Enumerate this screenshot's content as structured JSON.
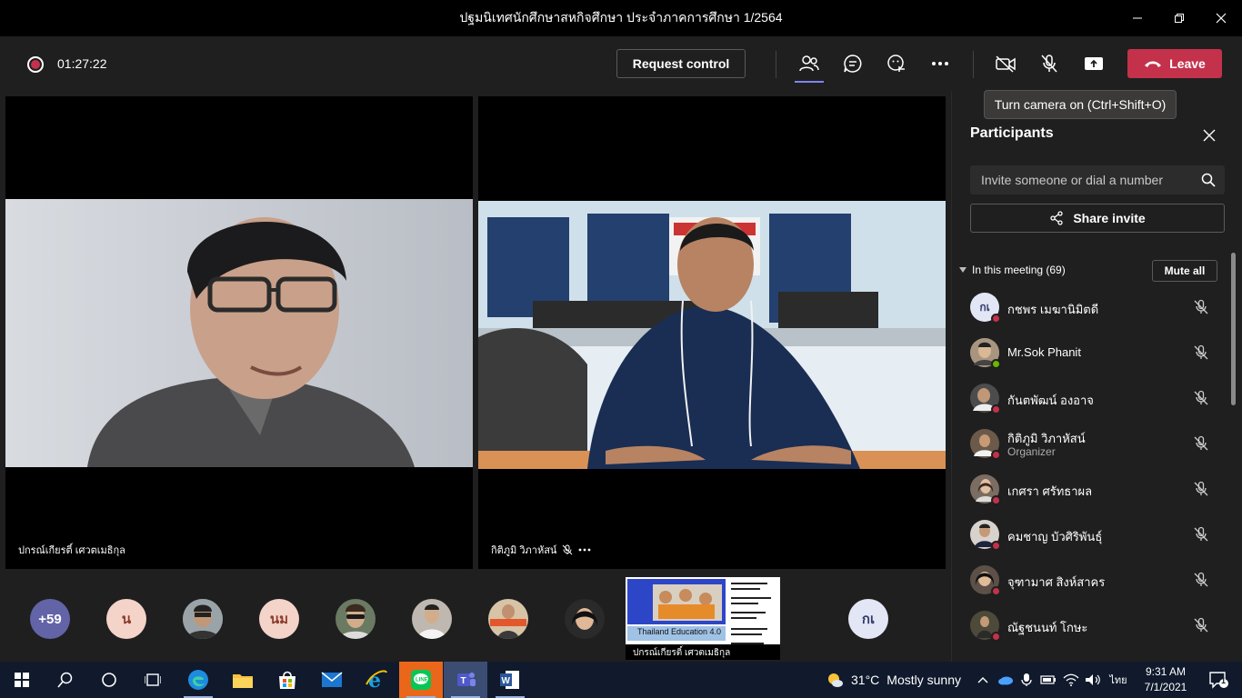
{
  "window": {
    "title": "ปฐมนิเทศนักศึกษาสหกิจศึกษา ประจำภาคการศึกษา 1/2564"
  },
  "toolbar": {
    "timer": "01:27:22",
    "request_control": "Request control",
    "leave": "Leave",
    "camera_tooltip": "Turn camera on (Ctrl+Shift+O)"
  },
  "videos": [
    {
      "name": "ปกรณ์เกียรติ์ เศวตเมธิกุล",
      "muted": false
    },
    {
      "name": "กิติภูมิ วิภาหัสน์",
      "muted": true
    }
  ],
  "strip": {
    "overflow_count": "+59",
    "avatars": [
      {
        "initials": "น",
        "bg": "#f4d3c9",
        "fg": "#8a3b2a"
      },
      {
        "initials": "",
        "photo": true
      },
      {
        "initials": "นม",
        "bg": "#f4d3c9",
        "fg": "#8a3b2a"
      },
      {
        "initials": "",
        "photo": true
      },
      {
        "initials": "",
        "photo": true
      },
      {
        "initials": "",
        "photo": true
      },
      {
        "initials": "",
        "photo": true
      },
      {
        "initials": "กเ",
        "bg": "#e3e6f5",
        "fg": "#333a6b"
      }
    ],
    "share_thumb": {
      "caption": "Thailand Education 4.0",
      "presenter": "ปกรณ์เกียรติ์ เศวตเมธิกุล"
    }
  },
  "panel": {
    "title": "Participants",
    "invite_placeholder": "Invite someone or dial a number",
    "share_invite": "Share invite",
    "section_label": "In this meeting (69)",
    "mute_all": "Mute all",
    "participants": [
      {
        "name": "กชพร เมฆานิมิตดี",
        "initials": "กเ",
        "status": "busy",
        "avatar_bg": "#e3e6f5"
      },
      {
        "name": "Mr.Sok Phanit",
        "initials": "",
        "status": "available",
        "avatar_bg": "#8a7560"
      },
      {
        "name": "กันตพัฒน์ องอาจ",
        "initials": "",
        "status": "busy",
        "avatar_bg": "#4c4c4c"
      },
      {
        "name": "กิติภูมิ วิภาหัสน์",
        "role": "Organizer",
        "initials": "",
        "status": "busy",
        "avatar_bg": "#6b5a4a"
      },
      {
        "name": "เกศรา ศรัทธาผล",
        "initials": "",
        "status": "busy",
        "avatar_bg": "#7b6d62"
      },
      {
        "name": "คมชาญ บัวศิริพันธุ์",
        "initials": "",
        "status": "busy",
        "avatar_bg": "#d8d2cc"
      },
      {
        "name": "จุฑามาศ สิงห์สาคร",
        "initials": "",
        "status": "busy",
        "avatar_bg": "#5c5048"
      },
      {
        "name": "ณัฐชนนท์ โกษะ",
        "initials": "",
        "status": "busy",
        "avatar_bg": "#4d4a3a"
      }
    ]
  },
  "taskbar": {
    "weather_temp": "31°C",
    "weather_desc": "Mostly sunny",
    "language": "ไทย",
    "time": "9:31 AM",
    "date": "7/1/2021",
    "notification_count": "1"
  },
  "colors": {
    "accent": "#7f85f5",
    "leave": "#c4314b",
    "busy": "#c4314b",
    "available": "#6bb700"
  }
}
